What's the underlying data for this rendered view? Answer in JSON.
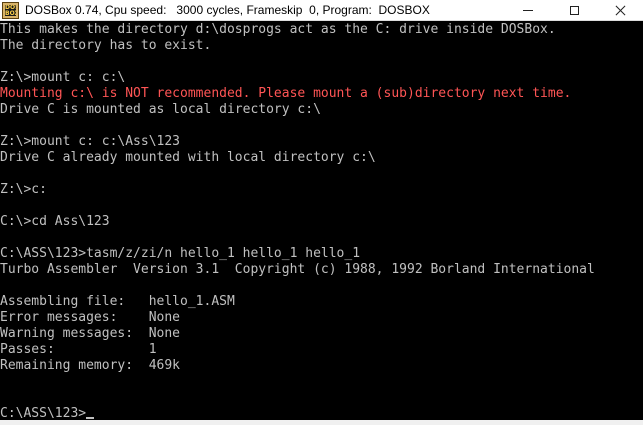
{
  "window": {
    "title_parts": [
      "DOSBox 0.74, Cpu speed:",
      "   3000 cycles, Frameskip  0, Program:",
      "  DOSBOX"
    ],
    "app_icon_text": "DOS BOX"
  },
  "console": {
    "lines": [
      {
        "text": "This makes the directory d:\\dosprogs act as the C: drive inside DOSBox.",
        "red": false
      },
      {
        "text": "The directory has to exist.",
        "red": false
      },
      {
        "text": "",
        "red": false
      },
      {
        "text": "Z:\\>mount c: c:\\",
        "red": false
      },
      {
        "text": "Mounting c:\\ is NOT recommended. Please mount a (sub)directory next time.",
        "red": true
      },
      {
        "text": "Drive C is mounted as local directory c:\\",
        "red": false
      },
      {
        "text": "",
        "red": false
      },
      {
        "text": "Z:\\>mount c: c:\\Ass\\123",
        "red": false
      },
      {
        "text": "Drive C already mounted with local directory c:\\",
        "red": false
      },
      {
        "text": "",
        "red": false
      },
      {
        "text": "Z:\\>c:",
        "red": false
      },
      {
        "text": "",
        "red": false
      },
      {
        "text": "C:\\>cd Ass\\123",
        "red": false
      },
      {
        "text": "",
        "red": false
      },
      {
        "text": "C:\\ASS\\123>tasm/z/zi/n hello_1 hello_1 hello_1",
        "red": false
      },
      {
        "text": "Turbo Assembler  Version 3.1  Copyright (c) 1988, 1992 Borland International",
        "red": false
      },
      {
        "text": "",
        "red": false
      },
      {
        "text": "Assembling file:   hello_1.ASM",
        "red": false
      },
      {
        "text": "Error messages:    None",
        "red": false
      },
      {
        "text": "Warning messages:  None",
        "red": false
      },
      {
        "text": "Passes:            1",
        "red": false
      },
      {
        "text": "Remaining memory:  469k",
        "red": false
      },
      {
        "text": "",
        "red": false
      },
      {
        "text": "",
        "red": false
      },
      {
        "text": "C:\\ASS\\123>",
        "red": false
      }
    ],
    "colors": {
      "text": "#c0c0c0",
      "warning": "#ff5555",
      "background": "#000000"
    }
  }
}
